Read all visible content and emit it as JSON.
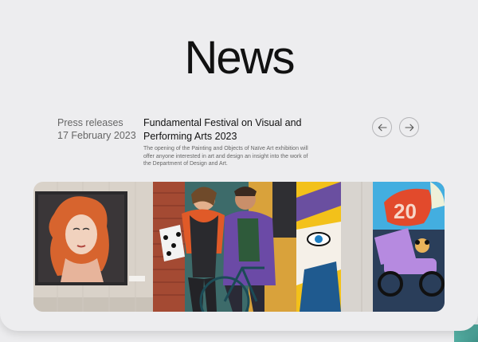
{
  "page": {
    "title": "News"
  },
  "article": {
    "category": "Press releases",
    "date": "17 February 2023",
    "headline": "Fundamental Festival on Visual and Performing Arts 2023",
    "excerpt": "The opening of the Painting and Objects of Naïve Art exhibition will offer anyone interested in art and design an insight into the work of the Department of Design and Art."
  },
  "nav": {
    "prev_icon": "arrow-left-icon",
    "next_icon": "arrow-right-icon"
  },
  "colors": {
    "background": "#ececee",
    "text": "#111111",
    "muted": "#666666",
    "accent": "#4fb3a6"
  }
}
